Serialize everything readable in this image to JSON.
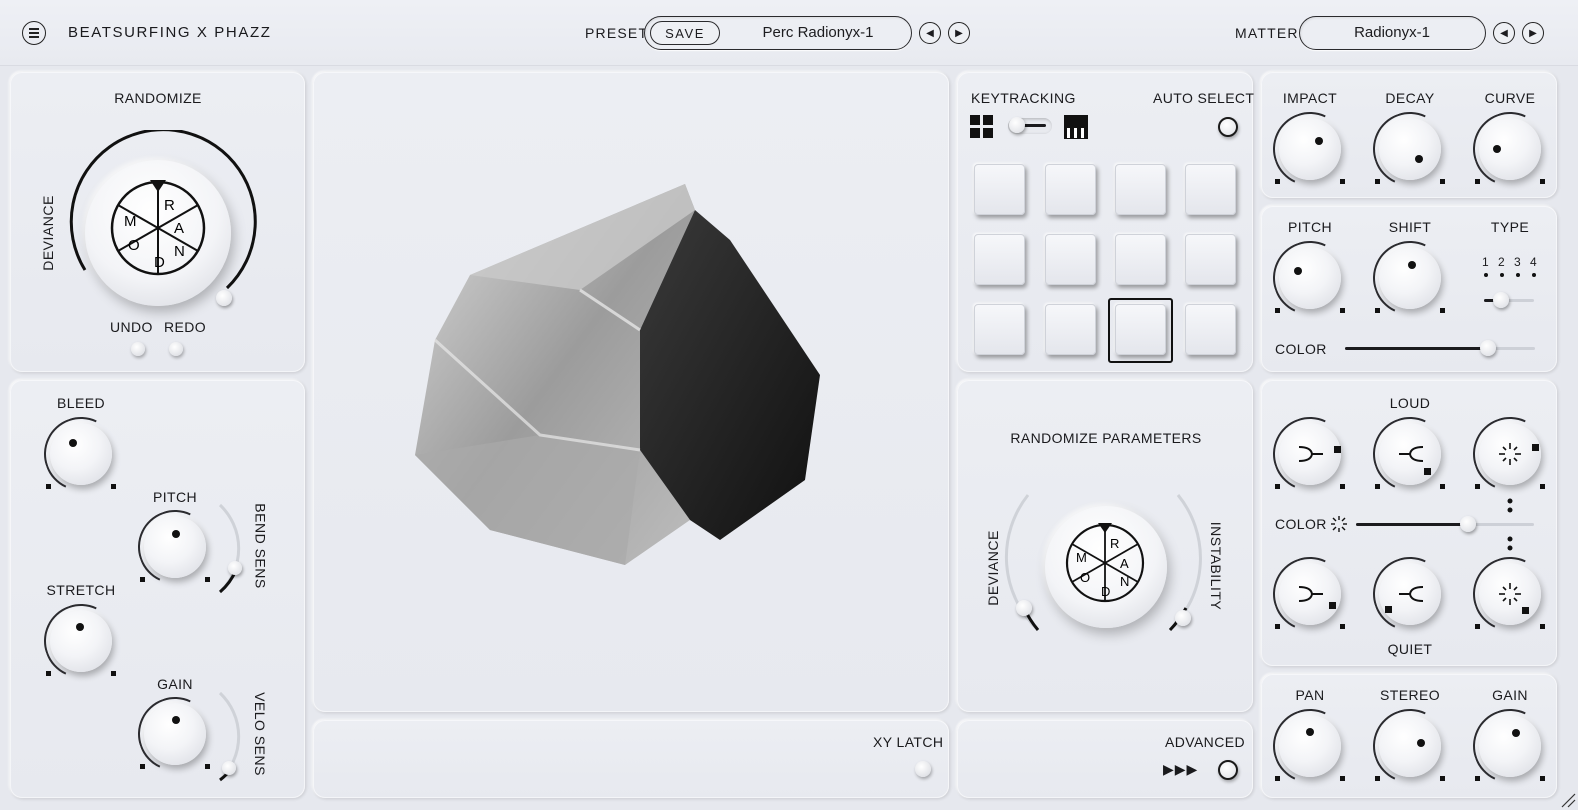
{
  "header": {
    "brand": "BEATSURFING X PHAZZ",
    "preset_label": "PRESET",
    "save_label": "SAVE",
    "preset_name": "Perc Radionyx-1",
    "matter_label": "MATTER",
    "matter_name": "Radionyx-1"
  },
  "randomize": {
    "title": "RANDOMIZE",
    "deviance_label": "DEVIANCE",
    "wheel_letters": [
      "R",
      "A",
      "N",
      "D",
      "O",
      "M"
    ],
    "undo_label": "UNDO",
    "redo_label": "REDO"
  },
  "modulation": {
    "bleed_label": "BLEED",
    "pitch_label": "PITCH",
    "bend_sens_label": "BEND SENS",
    "stretch_label": "STRETCH",
    "gain_label": "GAIN",
    "velo_sens_label": "VELO SENS"
  },
  "xy": {
    "latch_label": "XY LATCH"
  },
  "pads": {
    "keytracking_label": "KEYTRACKING",
    "auto_select_label": "AUTO SELECT",
    "rows": 3,
    "cols": 4,
    "selected_index": 10
  },
  "randomize_params": {
    "title": "RANDOMIZE PARAMETERS",
    "deviance_label": "DEVIANCE",
    "instability_label": "INSTABILITY",
    "wheel_letters": [
      "R",
      "A",
      "N",
      "D",
      "O",
      "M"
    ]
  },
  "advanced": {
    "label": "ADVANCED",
    "arrows": "▶▶▶"
  },
  "envelope": {
    "impact_label": "IMPACT",
    "decay_label": "DECAY",
    "curve_label": "CURVE"
  },
  "tone": {
    "pitch_label": "PITCH",
    "shift_label": "SHIFT",
    "type_label": "TYPE",
    "type_options": [
      "1",
      "2",
      "3",
      "4"
    ],
    "type_selected": "1",
    "color_label": "COLOR",
    "color_value": 0.75
  },
  "dynamics": {
    "loud_label": "LOUD",
    "quiet_label": "QUIET",
    "color_label": "COLOR",
    "color_value": 0.63
  },
  "output": {
    "pan_label": "PAN",
    "stereo_label": "STEREO",
    "gain_label": "GAIN"
  },
  "icons": {
    "menu": "menu-icon",
    "prev": "chevron-left-icon",
    "next": "chevron-right-icon",
    "grid": "grid-icon",
    "piano": "piano-icon",
    "spark": "spark-icon"
  },
  "colors": {
    "background": "#e6e8ee",
    "ink": "#1c1c1f",
    "accent": "#111111"
  }
}
